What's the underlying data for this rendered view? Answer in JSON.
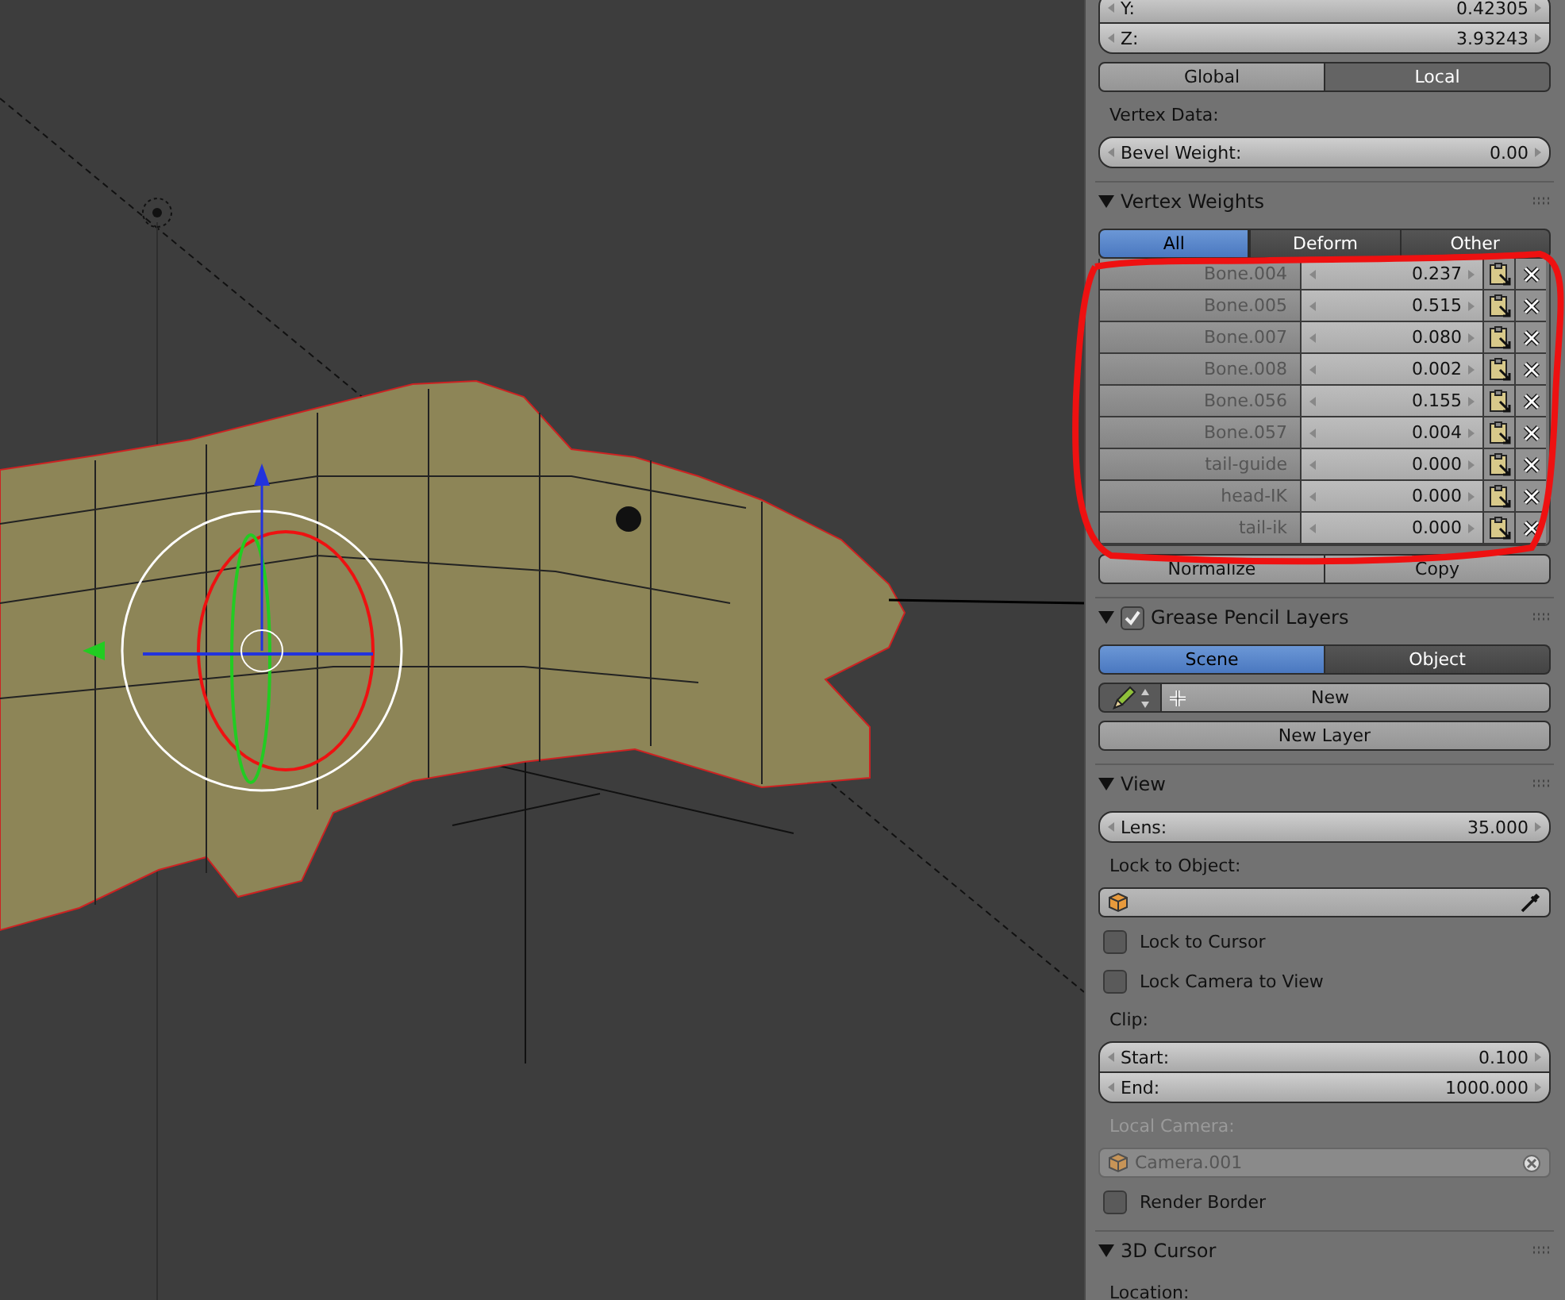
{
  "sidebar": {
    "sections": [
      {
        "kind": "body",
        "items": [
          {
            "kind": "number_group",
            "fields": [
              {
                "label": "Y:",
                "value": "0.42305"
              },
              {
                "label": "Z:",
                "value": "3.93243"
              }
            ]
          },
          {
            "kind": "toggle_pair",
            "options": [
              {
                "label": "Global",
                "pressed": false
              },
              {
                "label": "Local",
                "pressed": true
              }
            ]
          },
          {
            "kind": "label",
            "text": "Vertex Data:",
            "disabled": false
          },
          {
            "kind": "number",
            "label": "Bevel Weight:",
            "value": "0.00"
          }
        ]
      },
      {
        "kind": "panel",
        "title": "Vertex Weights",
        "expanded": true,
        "items": [
          {
            "kind": "tabs",
            "options": [
              {
                "label": "All",
                "selected": true
              },
              {
                "label": "Deform",
                "selected": false
              },
              {
                "label": "Other",
                "selected": false
              }
            ]
          },
          {
            "kind": "weights",
            "rows": [
              {
                "group": "Bone.004",
                "weight": "0.237"
              },
              {
                "group": "Bone.005",
                "weight": "0.515"
              },
              {
                "group": "Bone.007",
                "weight": "0.080"
              },
              {
                "group": "Bone.008",
                "weight": "0.002"
              },
              {
                "group": "Bone.056",
                "weight": "0.155"
              },
              {
                "group": "Bone.057",
                "weight": "0.004"
              },
              {
                "group": "tail-guide",
                "weight": "0.000"
              },
              {
                "group": "head-IK",
                "weight": "0.000"
              },
              {
                "group": "tail-ik",
                "weight": "0.000"
              }
            ]
          },
          {
            "kind": "button_pair",
            "buttons": [
              "Normalize",
              "Copy"
            ]
          }
        ]
      },
      {
        "kind": "panel",
        "title": "Grease Pencil Layers",
        "expanded": true,
        "enabled": true,
        "items": [
          {
            "kind": "tabs",
            "options": [
              {
                "label": "Scene",
                "selected": true
              },
              {
                "label": "Object",
                "selected": false
              }
            ]
          },
          {
            "kind": "datablock",
            "label": "New"
          },
          {
            "kind": "button",
            "label": "New Layer"
          }
        ]
      },
      {
        "kind": "panel",
        "title": "View",
        "expanded": true,
        "items": [
          {
            "kind": "number",
            "label": "Lens:",
            "value": "35.000"
          },
          {
            "kind": "label",
            "text": "Lock to Object:",
            "disabled": false
          },
          {
            "kind": "object_field",
            "value": "",
            "disabled": false
          },
          {
            "kind": "checkbox",
            "label": "Lock to Cursor",
            "checked": false
          },
          {
            "kind": "checkbox",
            "label": "Lock Camera to View",
            "checked": false
          },
          {
            "kind": "label",
            "text": "Clip:",
            "disabled": false
          },
          {
            "kind": "number_group",
            "fields": [
              {
                "label": "Start:",
                "value": "0.100"
              },
              {
                "label": "End:",
                "value": "1000.000"
              }
            ]
          },
          {
            "kind": "label",
            "text": "Local Camera:",
            "disabled": true
          },
          {
            "kind": "object_field",
            "value": "Camera.001",
            "disabled": true
          },
          {
            "kind": "checkbox",
            "label": "Render Border",
            "checked": false
          }
        ]
      },
      {
        "kind": "panel",
        "title": "3D Cursor",
        "expanded": true,
        "items": [
          {
            "kind": "label",
            "text": "Location:",
            "disabled": false
          }
        ]
      }
    ]
  }
}
